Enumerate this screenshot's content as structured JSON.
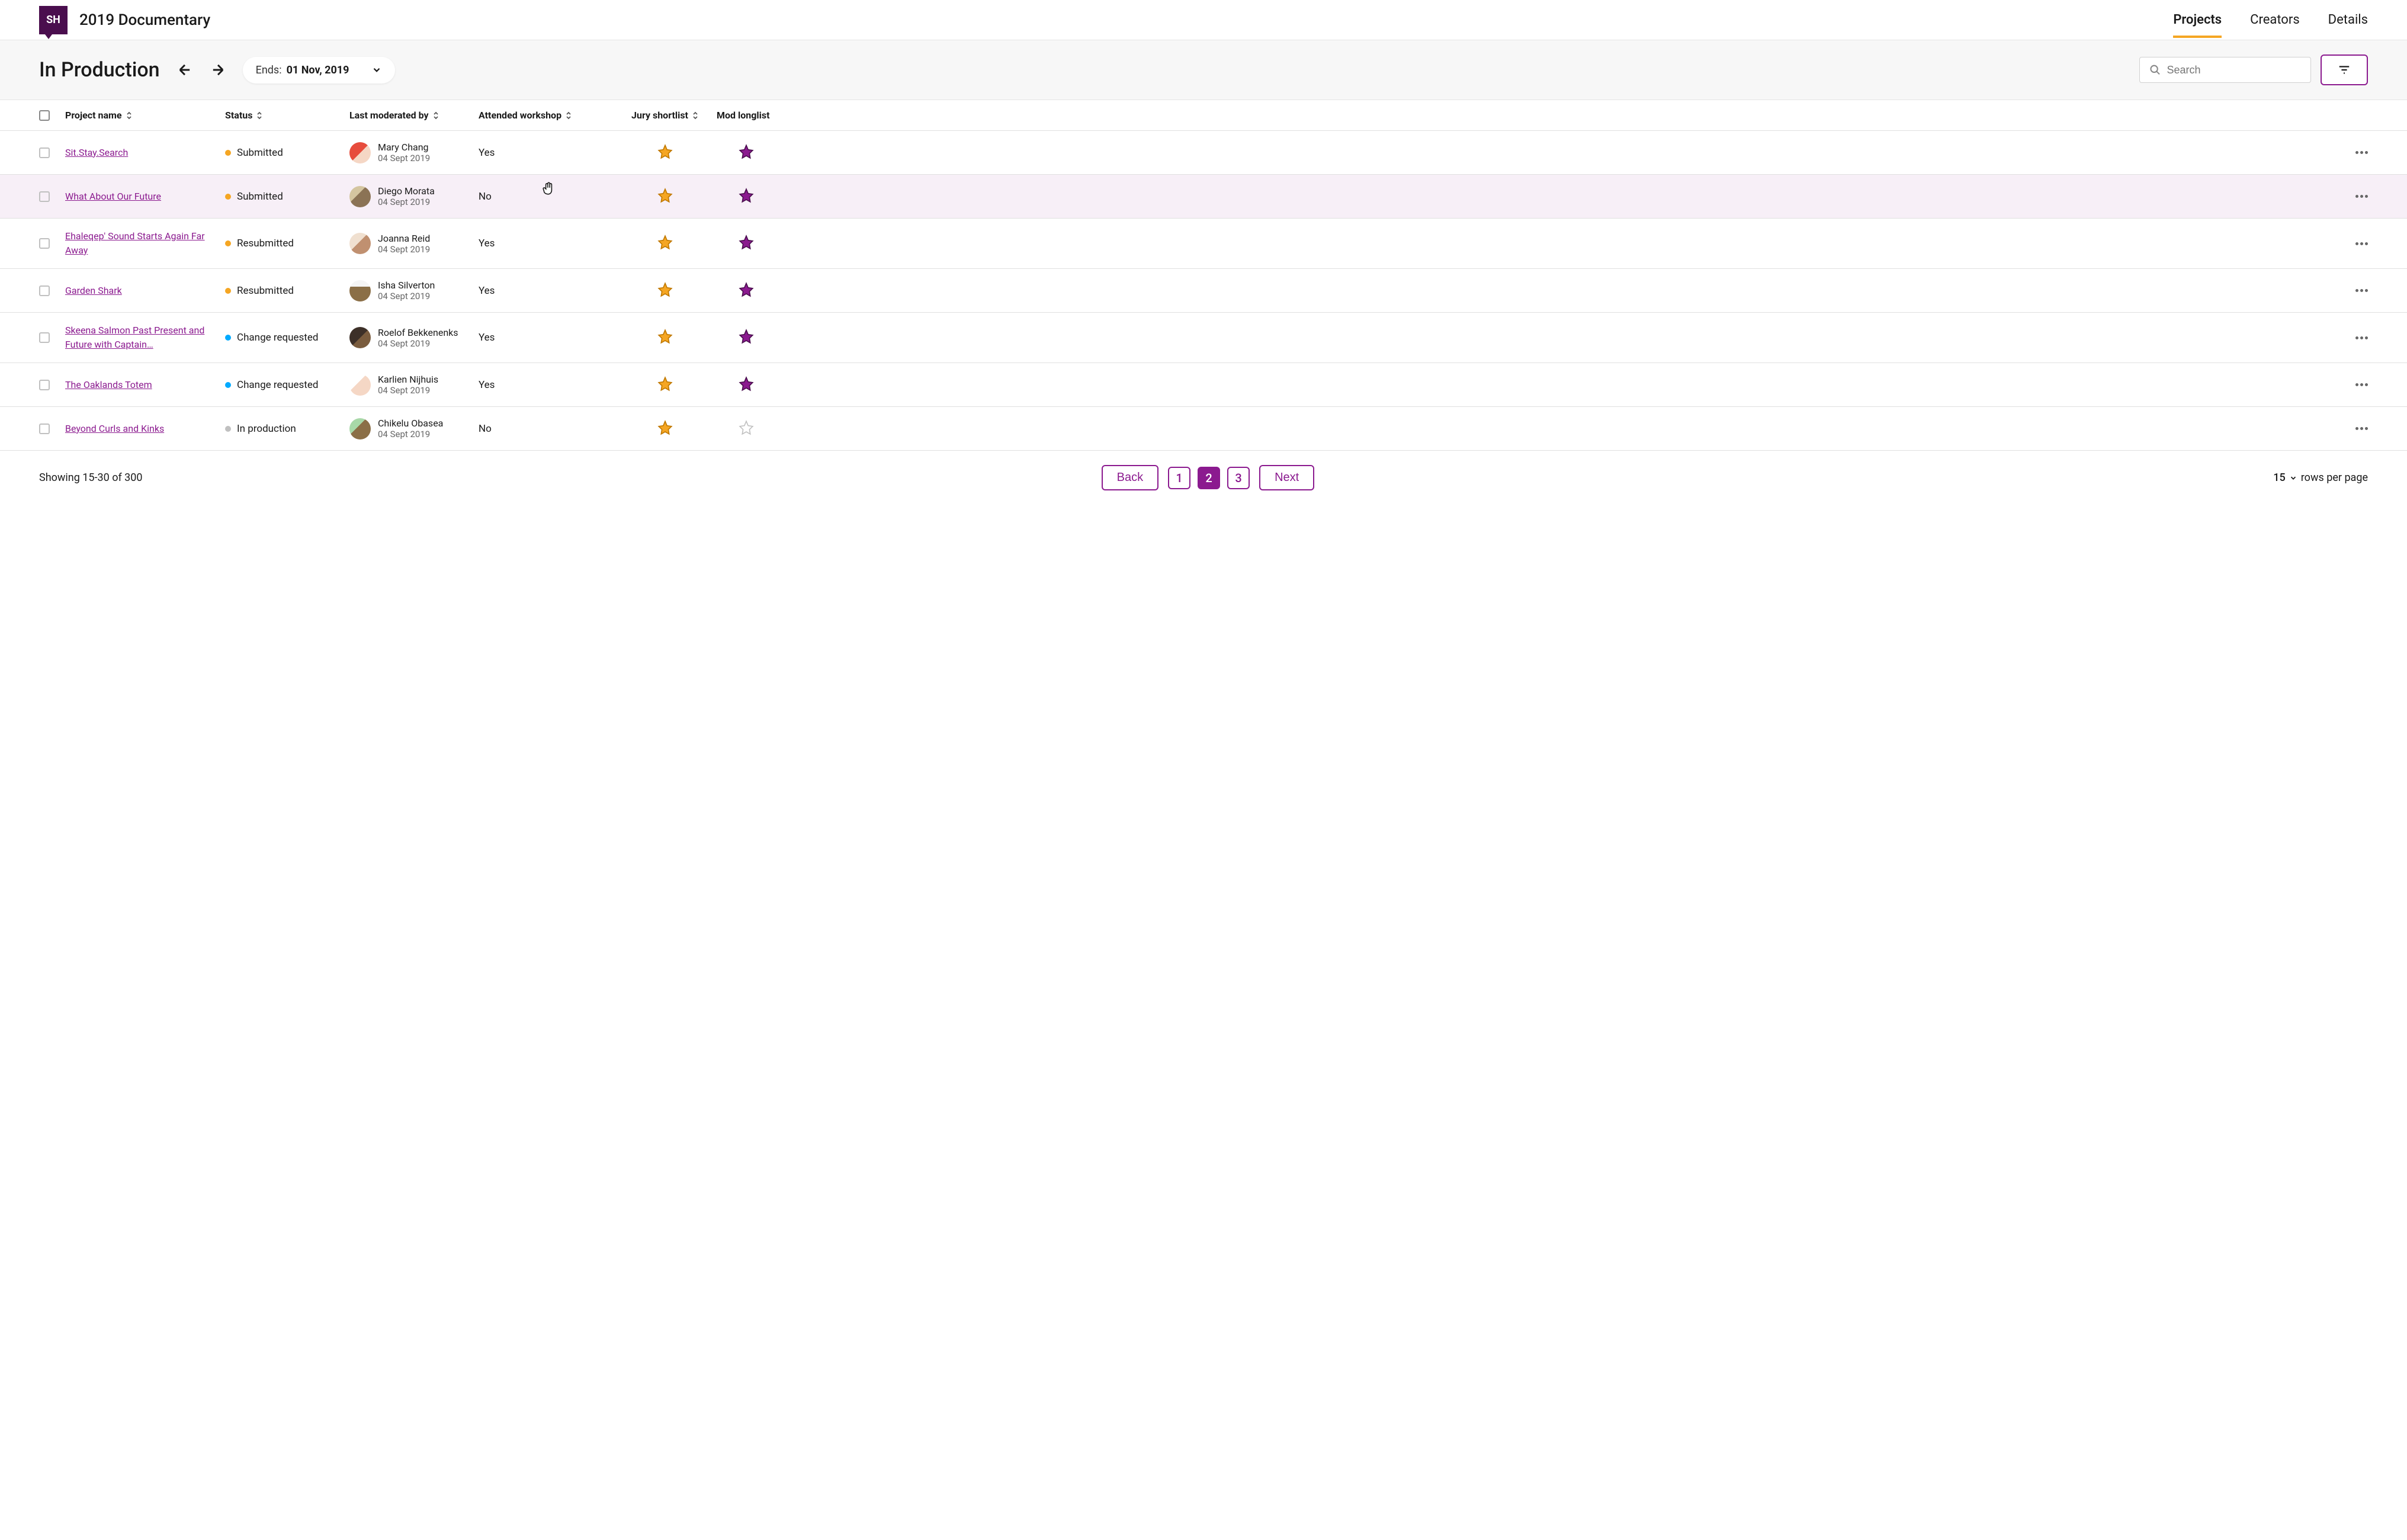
{
  "brand": {
    "logo": "SH",
    "title": "2019 Documentary"
  },
  "nav": {
    "items": [
      "Projects",
      "Creators",
      "Details"
    ],
    "activeIndex": 0
  },
  "toolbar": {
    "title": "In Production",
    "endsLabel": "Ends:",
    "endsDate": "01 Nov, 2019",
    "searchPlaceholder": "Search"
  },
  "columns": {
    "name": "Project name",
    "status": "Status",
    "moderated": "Last moderated by",
    "workshop": "Attended workshop",
    "jury": "Jury shortlist",
    "longlist": "Mod longlist"
  },
  "rows": [
    {
      "name": "Sit.Stay.Search",
      "status": "Submitted",
      "statusColor": "submitted",
      "moderator": "Mary Chang",
      "date": "04 Sept 2019",
      "workshop": "Yes",
      "jury": true,
      "longlist": true,
      "avatar": "a1"
    },
    {
      "name": "What About Our Future",
      "status": "Submitted",
      "statusColor": "submitted",
      "moderator": "Diego Morata",
      "date": "04 Sept 2019",
      "workshop": "No",
      "jury": true,
      "longlist": true,
      "avatar": "a2",
      "hovered": true
    },
    {
      "name": "Ehaleqep' Sound Starts Again Far Away",
      "status": "Resubmitted",
      "statusColor": "resubmitted",
      "moderator": "Joanna Reid",
      "date": "04 Sept 2019",
      "workshop": "Yes",
      "jury": true,
      "longlist": true,
      "avatar": "a3"
    },
    {
      "name": "Garden Shark",
      "status": "Resubmitted",
      "statusColor": "resubmitted",
      "moderator": "Isha Silverton",
      "date": "04 Sept 2019",
      "workshop": "Yes",
      "jury": true,
      "longlist": true,
      "avatar": "a4"
    },
    {
      "name": "Skeena Salmon Past Present and Future with Captain…",
      "status": "Change requested",
      "statusColor": "change",
      "moderator": "Roelof Bekkenenks",
      "date": "04 Sept 2019",
      "workshop": "Yes",
      "jury": true,
      "longlist": true,
      "avatar": "a5"
    },
    {
      "name": "The Oaklands Totem",
      "status": "Change requested",
      "statusColor": "change",
      "moderator": "Karlien Nijhuis",
      "date": "04 Sept 2019",
      "workshop": "Yes",
      "jury": true,
      "longlist": true,
      "avatar": "a6"
    },
    {
      "name": "Beyond Curls and Kinks",
      "status": "In production",
      "statusColor": "production",
      "moderator": "Chikelu Obasea",
      "date": "04 Sept 2019",
      "workshop": "No",
      "jury": true,
      "longlist": false,
      "avatar": "a7"
    }
  ],
  "footer": {
    "showing": "Showing 15-30 of 300",
    "back": "Back",
    "next": "Next",
    "pages": [
      "1",
      "2",
      "3"
    ],
    "activePage": 1,
    "rowsCount": "15",
    "rowsLabel": "rows per page"
  }
}
